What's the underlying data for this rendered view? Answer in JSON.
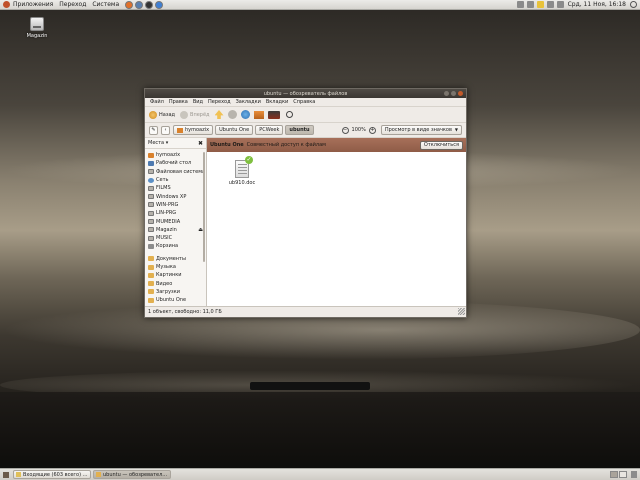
{
  "top_panel": {
    "menus": [
      "Приложения",
      "Переход",
      "Система"
    ],
    "clock": "Срд, 11 Ноя, 16:18"
  },
  "desktop": {
    "icon_label": "Magazin"
  },
  "window": {
    "title": "ubuntu — обозреватель файлов",
    "menu": [
      "Файл",
      "Правка",
      "Вид",
      "Переход",
      "Закладки",
      "Вкладки",
      "Справка"
    ],
    "toolbar": {
      "back": "Назад",
      "forward": "Вперёд"
    },
    "breadcrumbs": [
      "hymoazix",
      "Ubuntu One",
      "PCWeek",
      "ubuntu"
    ],
    "zoom": "100%",
    "view_mode": "Просмотр в виде значков",
    "sidebar": {
      "header": "Места",
      "places": [
        {
          "label": "hymoazix",
          "icon": "home-folder-icon"
        },
        {
          "label": "Рабочий стол",
          "icon": "desktop-icon"
        },
        {
          "label": "Файловая система",
          "icon": "drive-icon"
        },
        {
          "label": "Сеть",
          "icon": "network-icon"
        },
        {
          "label": "FILMS",
          "icon": "drive-icon"
        },
        {
          "label": "Windows XP",
          "icon": "drive-icon"
        },
        {
          "label": "WIN-PRG",
          "icon": "drive-icon"
        },
        {
          "label": "LIN-PRG",
          "icon": "drive-icon"
        },
        {
          "label": "MUMEDIA",
          "icon": "drive-icon"
        },
        {
          "label": "Magazin",
          "icon": "drive-icon"
        },
        {
          "label": "MUSIC",
          "icon": "drive-icon"
        },
        {
          "label": "Корзина",
          "icon": "trash-icon"
        }
      ],
      "bookmarks": [
        {
          "label": "Документы",
          "icon": "folder-icon"
        },
        {
          "label": "Музыка",
          "icon": "folder-icon"
        },
        {
          "label": "Картинки",
          "icon": "folder-icon"
        },
        {
          "label": "Видео",
          "icon": "folder-icon"
        },
        {
          "label": "Загрузки",
          "icon": "folder-icon"
        },
        {
          "label": "Ubuntu One",
          "icon": "folder-icon"
        }
      ]
    },
    "banner": {
      "title": "Ubuntu One",
      "subtitle": "Совместный доступ к файлам",
      "button": "Отключиться"
    },
    "files": [
      {
        "name": "ub910.doc",
        "icon": "document-icon",
        "synced": true
      }
    ],
    "status": "1 объект, свободно: 11,0 ГБ"
  },
  "bottom_panel": {
    "tasks": [
      "Входящие (603 всего) ...",
      "ubuntu — обозревател..."
    ]
  }
}
